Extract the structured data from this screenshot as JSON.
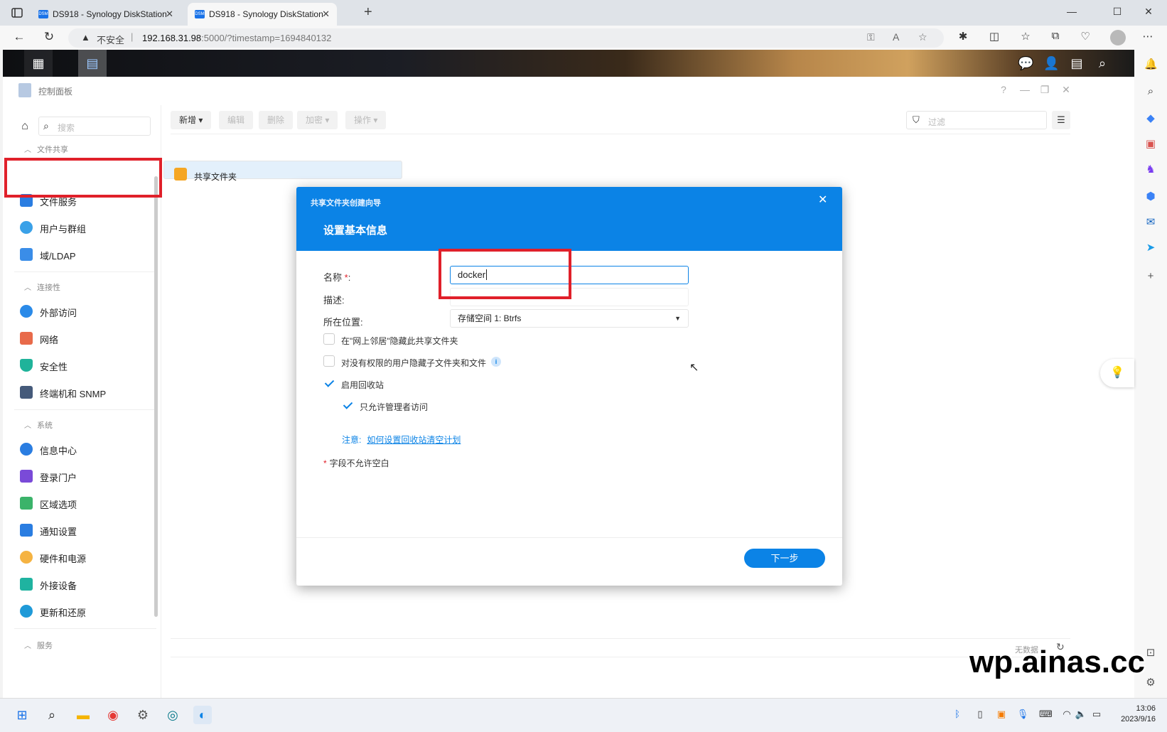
{
  "browser": {
    "tabs": [
      {
        "title": "DS918 - Synology DiskStation",
        "favicon": "DSM"
      },
      {
        "title": "DS918 - Synology DiskStation",
        "favicon": "DSM"
      }
    ],
    "address": {
      "security_label": "不安全",
      "host": "192.168.31.98",
      "path": ":5000/?timestamp=1694840132"
    }
  },
  "control_panel": {
    "title": "控制面板",
    "search_placeholder": "搜索",
    "sections": [
      {
        "label": "文件共享",
        "items": [
          "共享文件夹",
          "文件服务",
          "用户与群组",
          "域/LDAP"
        ]
      },
      {
        "label": "连接性",
        "items": [
          "外部访问",
          "网络",
          "安全性",
          "终端机和 SNMP"
        ]
      },
      {
        "label": "系统",
        "items": [
          "信息中心",
          "登录门户",
          "区域选项",
          "通知设置",
          "硬件和电源",
          "外接设备",
          "更新和还原"
        ]
      },
      {
        "label": "服务",
        "items": []
      }
    ],
    "toolbar": {
      "create": "新增",
      "edit": "编辑",
      "delete": "删除",
      "encrypt": "加密",
      "action": "操作",
      "filter_placeholder": "过滤"
    },
    "status": "无数据"
  },
  "dialog": {
    "subtitle": "共享文件夹创建向导",
    "title": "设置基本信息",
    "name_label": "名称",
    "name_required": "*",
    "name_colon": ":",
    "name_value": "docker",
    "desc_label": "描述:",
    "location_label": "所在位置:",
    "location_value": "存储空间 1:   Btrfs",
    "options": [
      {
        "label": "在\"网上邻居\"隐藏此共享文件夹",
        "checked": false
      },
      {
        "label": "对没有权限的用户隐藏子文件夹和文件",
        "checked": false
      },
      {
        "label": "启用回收站",
        "checked": true
      },
      {
        "label": "只允许管理者访问",
        "checked": true
      }
    ],
    "note_label": "注意:",
    "note_link": "如何设置回收站清空计划",
    "required_note_mark": "*",
    "required_note": "字段不允许空白",
    "next_button": "下一步"
  },
  "watermark": "wp.ainas.cc",
  "taskbar": {
    "time": "13:06",
    "date": "2023/9/16"
  },
  "colors": {
    "accent": "#0b83e6",
    "highlight": "#e0202a"
  }
}
